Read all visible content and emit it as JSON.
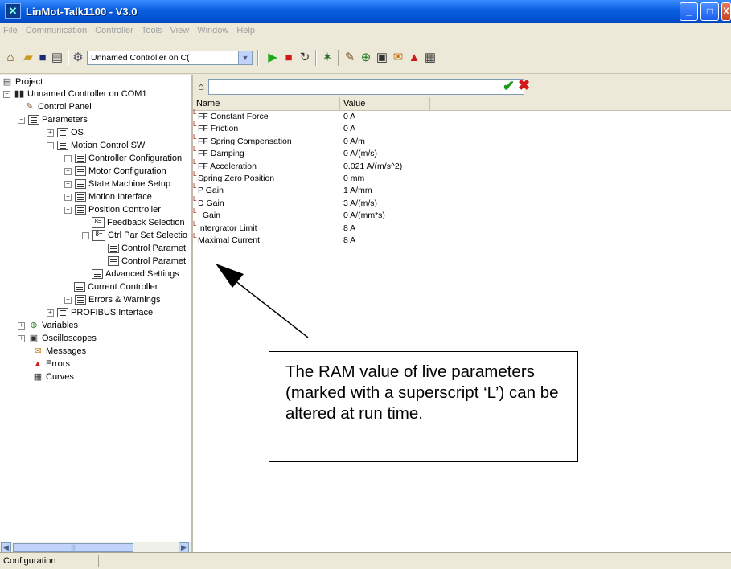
{
  "window": {
    "title": "LinMot-Talk1100 - V3.0",
    "minimize": "_",
    "maximize": "□",
    "close": "X"
  },
  "menu": [
    "File",
    "Communication",
    "Controller",
    "Tools",
    "View",
    "Window",
    "Help"
  ],
  "toolbar": {
    "controller_select": "Unnamed Controller on C("
  },
  "tree": [
    {
      "label": "Project",
      "icon": "project-icon"
    },
    {
      "label": "Unnamed Controller on COM1",
      "icon": "controller-icon"
    },
    {
      "label": "Control Panel",
      "icon": "control-panel-icon"
    },
    {
      "label": "Parameters",
      "icon": "parameters-icon"
    },
    {
      "label": "OS",
      "icon": "document-icon"
    },
    {
      "label": "Motion Control SW",
      "icon": "document-icon"
    },
    {
      "label": "Controller Configuration",
      "icon": "document-icon"
    },
    {
      "label": "Motor Configuration",
      "icon": "document-icon"
    },
    {
      "label": "State Machine Setup",
      "icon": "document-icon"
    },
    {
      "label": "Motion Interface",
      "icon": "document-icon"
    },
    {
      "label": "Position Controller",
      "icon": "document-icon"
    },
    {
      "label": "Feedback Selection",
      "icon": "selection-icon"
    },
    {
      "label": "Ctrl Par Set Selectio",
      "icon": "selection-icon"
    },
    {
      "label": "Control Paramet",
      "icon": "document-icon"
    },
    {
      "label": "Control Paramet",
      "icon": "document-icon"
    },
    {
      "label": "Advanced Settings",
      "icon": "document-icon"
    },
    {
      "label": "Current Controller",
      "icon": "document-icon"
    },
    {
      "label": "Errors & Warnings",
      "icon": "document-icon"
    },
    {
      "label": "PROFIBUS Interface",
      "icon": "document-icon"
    },
    {
      "label": "Variables",
      "icon": "variables-icon"
    },
    {
      "label": "Oscilloscopes",
      "icon": "oscilloscope-icon"
    },
    {
      "label": "Messages",
      "icon": "messages-icon"
    },
    {
      "label": "Errors",
      "icon": "errors-icon"
    },
    {
      "label": "Curves",
      "icon": "curves-icon"
    }
  ],
  "table": {
    "headers": {
      "name": "Name",
      "value": "Value"
    },
    "live_marker": "L",
    "rows": [
      {
        "name": "FF Constant Force",
        "value": "0 A"
      },
      {
        "name": "FF Friction",
        "value": "0 A"
      },
      {
        "name": "FF Spring Compensation",
        "value": "0 A/m"
      },
      {
        "name": "FF Damping",
        "value": "0 A/(m/s)"
      },
      {
        "name": "FF Acceleration",
        "value": "0.021 A/(m/s^2)"
      },
      {
        "name": "Spring Zero Position",
        "value": "0 mm"
      },
      {
        "name": "P Gain",
        "value": "1 A/mm"
      },
      {
        "name": "D Gain",
        "value": "3 A/(m/s)"
      },
      {
        "name": "I Gain",
        "value": "0 A/(mm*s)"
      },
      {
        "name": "Intergrator Limit",
        "value": "8 A"
      },
      {
        "name": "Maximal Current",
        "value": "8 A"
      }
    ]
  },
  "callout": {
    "text": "The RAM value of live parameters (marked with a superscript ‘L’) can be altered at run time."
  },
  "status": {
    "panel1": "Configuration"
  }
}
